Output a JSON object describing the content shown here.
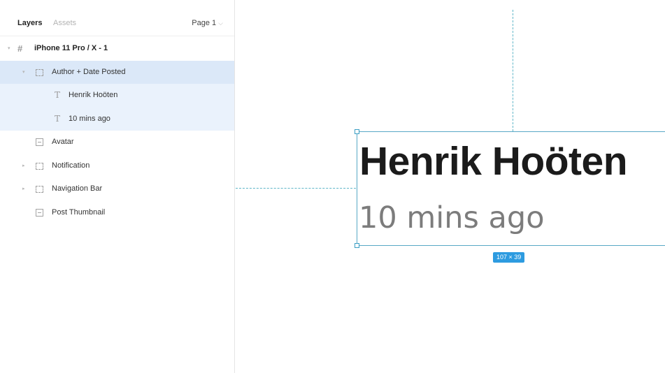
{
  "sidebar": {
    "tabs": {
      "layers": "Layers",
      "assets": "Assets"
    },
    "page_select": {
      "label": "Page 1",
      "icon": "chevron-down-icon"
    },
    "layers": [
      {
        "label": "iPhone 11 Pro / X - 1",
        "icon": "frame-hash-icon",
        "caret": "▾"
      },
      {
        "label": "Author + Date Posted",
        "icon": "group-dashed-icon",
        "caret": "▾"
      },
      {
        "label": "Henrik Hoöten",
        "icon": "text-t-icon",
        "glyph": "T"
      },
      {
        "label": "10 mins ago",
        "icon": "text-t-icon",
        "glyph": "T"
      },
      {
        "label": "Avatar",
        "icon": "image-icon"
      },
      {
        "label": "Notification",
        "icon": "group-dashed-icon",
        "caret": "▸"
      },
      {
        "label": "Navigation Bar",
        "icon": "group-dashed-icon",
        "caret": "▸"
      },
      {
        "label": "Post Thumbnail",
        "icon": "image-icon"
      }
    ],
    "frame_glyph": "#"
  },
  "canvas": {
    "name_text": "Henrik Hoöten",
    "time_text": "10 mins ago",
    "size_badge": "107 × 39"
  },
  "colors": {
    "selection_parent": "#dbe8f8",
    "selection_child": "#eaf2fc",
    "accent": "#2d9be0",
    "guide": "#5fb6c8"
  }
}
